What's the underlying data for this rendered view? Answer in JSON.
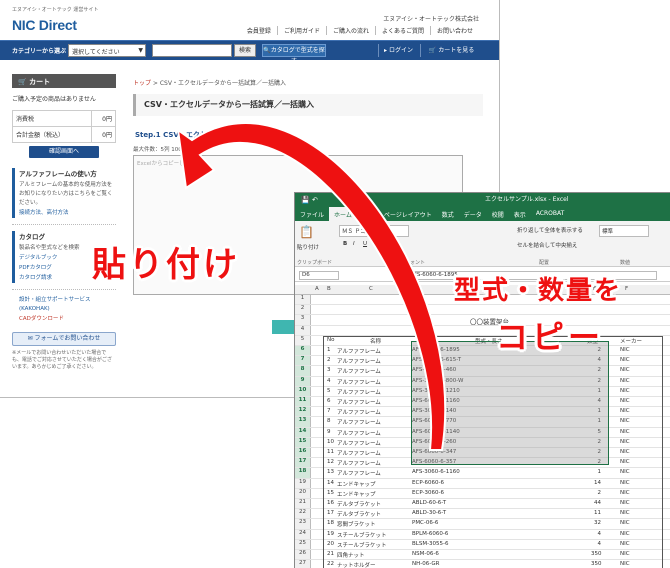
{
  "site": {
    "tagline": "エヌアイシ・オートテック 運営サイト",
    "logo": "NIC Direct",
    "company": "エヌアイシ・オートテック株式会社",
    "top_links": [
      "会員登録",
      "ご利用ガイド",
      "ご購入の流れ",
      "よくあるご質問",
      "お問い合わせ"
    ],
    "search": {
      "category_label": "カテゴリーから選ぶ",
      "category_value": "選択してください",
      "search_button": "検索",
      "catalog_button": "カタログで型式を探す",
      "login": "ログイン",
      "cart": "カートを見る"
    },
    "sidebar": {
      "cart_title": "カート",
      "cart_empty": "ご購入予定の商品はありません",
      "rows": [
        {
          "label": "消費税",
          "value": "0円"
        },
        {
          "label": "合計金額（税込）",
          "value": "0円"
        }
      ],
      "confirm": "確認画面へ",
      "howto": {
        "title": "アルファフレームの使い方",
        "text": "アルミフレームの基本的な使用方法をお知りになりたい方はこちらをご覧ください。",
        "link": "接続方法、高付方法"
      },
      "catalog": {
        "title": "カタログ",
        "text": "製品名や型式などを検索",
        "links": [
          "デジタルブック",
          "PDFカタログ",
          "カタログ請求"
        ]
      },
      "design": {
        "links": [
          "設計・組立サポートサービス(KAKOHAK)",
          "CADダウンロード"
        ]
      },
      "inquiry": "フォームでお問い合わせ",
      "note": "※メールでお問い合わせいただいた場合でも、電話でご対応させていただく場合がございます。あらかじめご了承ください。"
    },
    "breadcrumb": {
      "home": "トップ",
      "current": "CSV・エクセルデータから一括試算／一括購入"
    },
    "page_title": "CSV・エクセルデータから一括試算／一括購入",
    "step": "Step.1 CSV・エクセルデータ",
    "max_lines": "最大件数：5列 100行",
    "textarea_placeholder": "Excelからコピーしたデ"
  },
  "excel": {
    "title": "エクセルサンプル.xlsx - Excel",
    "tabs": [
      "ファイル",
      "ホーム",
      "挿入",
      "ページレイアウト",
      "数式",
      "データ",
      "校閲",
      "表示",
      "ACROBAT"
    ],
    "ribbon": {
      "paste": "貼り付け",
      "clipboard": "クリップボード",
      "font_name": "ＭＳ Ｐゴシック",
      "font_label": "フォント",
      "wrap": "折り返して全体を表示する",
      "merge": "セルを結合して中央揃え",
      "align_label": "配置",
      "number_format": "標準",
      "number_label": "数値"
    },
    "name_box": "D6",
    "formula": "AFS-6060-6-1895",
    "columns": [
      "A",
      "B",
      "C",
      "D",
      "E",
      "F"
    ],
    "sheet_title": "〇〇装置架台",
    "headers": {
      "no": "No",
      "name": "名称",
      "model": "型式・長さ",
      "qty": "数量",
      "maker": "メーカー"
    },
    "rows": [
      {
        "r": 6,
        "no": "1",
        "name": "アルファフレーム",
        "model": "AFS-6060-6-1895",
        "qty": "2",
        "maker": "NIC"
      },
      {
        "r": 7,
        "no": "2",
        "name": "アルファフレーム",
        "model": "AFS-6060-6-615-T",
        "qty": "4",
        "maker": "NIC"
      },
      {
        "r": 8,
        "no": "3",
        "name": "アルファフレーム",
        "model": "AFS-6060-6-460",
        "qty": "2",
        "maker": "NIC"
      },
      {
        "r": 9,
        "no": "4",
        "name": "アルファフレーム",
        "model": "AFS-3060-6-800-W",
        "qty": "2",
        "maker": "NIC"
      },
      {
        "r": 10,
        "no": "5",
        "name": "アルファフレーム",
        "model": "AFS-3060-6-1210",
        "qty": "1",
        "maker": "NIC"
      },
      {
        "r": 11,
        "no": "6",
        "name": "アルファフレーム",
        "model": "AFS-6060-6-1160",
        "qty": "4",
        "maker": "NIC"
      },
      {
        "r": 12,
        "no": "7",
        "name": "アルファフレーム",
        "model": "AFS-3060-6-140",
        "qty": "1",
        "maker": "NIC"
      },
      {
        "r": 13,
        "no": "8",
        "name": "アルファフレーム",
        "model": "AFS-6060-6-770",
        "qty": "1",
        "maker": "NIC"
      },
      {
        "r": 14,
        "no": "9",
        "name": "アルファフレーム",
        "model": "AFS-6060-6-1140",
        "qty": "5",
        "maker": "NIC"
      },
      {
        "r": 15,
        "no": "10",
        "name": "アルファフレーム",
        "model": "AFS-6060-6-260",
        "qty": "2",
        "maker": "NIC"
      },
      {
        "r": 16,
        "no": "11",
        "name": "アルファフレーム",
        "model": "AFS-6060-6-347",
        "qty": "2",
        "maker": "NIC"
      },
      {
        "r": 17,
        "no": "12",
        "name": "アルファフレーム",
        "model": "AFS-6060-6-357",
        "qty": "2",
        "maker": "NIC"
      },
      {
        "r": 18,
        "no": "13",
        "name": "アルファフレーム",
        "model": "AFS-3060-6-1160",
        "qty": "1",
        "maker": "NIC"
      },
      {
        "r": 19,
        "no": "14",
        "name": "エンドキャップ",
        "model": "ECP-6060-6",
        "qty": "14",
        "maker": "NIC"
      },
      {
        "r": 20,
        "no": "15",
        "name": "エンドキャップ",
        "model": "ECP-3060-6",
        "qty": "2",
        "maker": "NIC"
      },
      {
        "r": 21,
        "no": "16",
        "name": "デルタブラケット",
        "model": "ABLD-60-6-T",
        "qty": "44",
        "maker": "NIC"
      },
      {
        "r": 22,
        "no": "17",
        "name": "デルタブラケット",
        "model": "ABLD-30-6-T",
        "qty": "11",
        "maker": "NIC"
      },
      {
        "r": 23,
        "no": "18",
        "name": "窓間ブラケット",
        "model": "PMC-06-6",
        "qty": "32",
        "maker": "NIC"
      },
      {
        "r": 24,
        "no": "19",
        "name": "スチールブラケット",
        "model": "BPLM-6060-6",
        "qty": "4",
        "maker": "NIC"
      },
      {
        "r": 25,
        "no": "20",
        "name": "スチールブラケット",
        "model": "BLSM-3055-6",
        "qty": "4",
        "maker": "NIC"
      },
      {
        "r": 26,
        "no": "21",
        "name": "四角ナット",
        "model": "NSM-06-6",
        "qty": "350",
        "maker": "NIC"
      },
      {
        "r": 27,
        "no": "22",
        "name": "ナットホルダー",
        "model": "NH-06-GR",
        "qty": "350",
        "maker": "NIC"
      }
    ]
  },
  "annotations": {
    "paste": "貼り付け",
    "copy_line1": "型式・数量を",
    "copy_line2": "コピー",
    "arrow_color": "#ee1111"
  }
}
